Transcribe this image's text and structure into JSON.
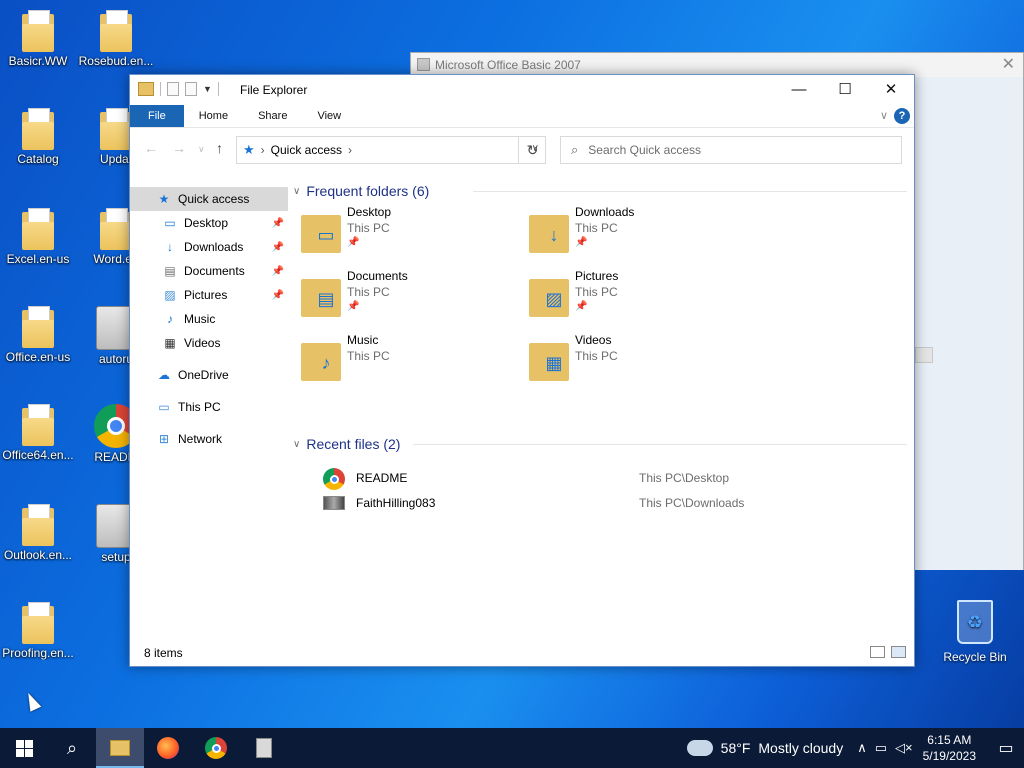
{
  "desktop": {
    "icons": [
      {
        "label": "Basicr.WW",
        "kind": "folder"
      },
      {
        "label": "Rosebud.en...",
        "kind": "folder"
      },
      {
        "label": "Catalog",
        "kind": "folder"
      },
      {
        "label": "Updat",
        "kind": "folder"
      },
      {
        "label": "Excel.en-us",
        "kind": "folder"
      },
      {
        "label": "Word.en",
        "kind": "folder"
      },
      {
        "label": "Office.en-us",
        "kind": "folder"
      },
      {
        "label": "autoru",
        "kind": "setup"
      },
      {
        "label": "Office64.en...",
        "kind": "folder"
      },
      {
        "label": "READM",
        "kind": "chrome"
      },
      {
        "label": "Outlook.en...",
        "kind": "folder"
      },
      {
        "label": "setup",
        "kind": "setup"
      },
      {
        "label": "Proofing.en...",
        "kind": "folder"
      }
    ],
    "recycle_bin": "Recycle Bin"
  },
  "office_window": {
    "title": "Microsoft Office Basic 2007",
    "close": "✕"
  },
  "explorer": {
    "title": "File Explorer",
    "controls": {
      "minimize": "—",
      "maximize": "☐",
      "close": "✕"
    },
    "ribbon_tabs": [
      "File",
      "Home",
      "Share",
      "View"
    ],
    "address": {
      "location": "Quick access"
    },
    "search_placeholder": "Search Quick access",
    "sidebar": [
      {
        "label": "Quick access",
        "icon": "star-icon",
        "glyph": "★",
        "color": "#1a74d6",
        "selected": true,
        "sub": false,
        "pinned": false
      },
      {
        "label": "Desktop",
        "icon": "desktop-icon",
        "glyph": "▭",
        "color": "#1a74d6",
        "selected": false,
        "sub": true,
        "pinned": true
      },
      {
        "label": "Downloads",
        "icon": "download-icon",
        "glyph": "↓",
        "color": "#1a74d6",
        "selected": false,
        "sub": true,
        "pinned": true
      },
      {
        "label": "Documents",
        "icon": "document-icon",
        "glyph": "▤",
        "color": "#6d6d6d",
        "selected": false,
        "sub": true,
        "pinned": true
      },
      {
        "label": "Pictures",
        "icon": "picture-icon",
        "glyph": "▨",
        "color": "#3a8ad6",
        "selected": false,
        "sub": true,
        "pinned": true
      },
      {
        "label": "Music",
        "icon": "music-icon",
        "glyph": "♪",
        "color": "#1a74d6",
        "selected": false,
        "sub": true,
        "pinned": false
      },
      {
        "label": "Videos",
        "icon": "video-icon",
        "glyph": "▦",
        "color": "#333333",
        "selected": false,
        "sub": true,
        "pinned": false
      },
      {
        "label": "OneDrive",
        "icon": "cloud-icon",
        "glyph": "☁",
        "color": "#1a74d6",
        "selected": false,
        "sub": false,
        "pinned": false
      },
      {
        "label": "This PC",
        "icon": "computer-icon",
        "glyph": "▭",
        "color": "#3a8ad6",
        "selected": false,
        "sub": false,
        "pinned": false
      },
      {
        "label": "Network",
        "icon": "network-icon",
        "glyph": "⊞",
        "color": "#3a8ad6",
        "selected": false,
        "sub": false,
        "pinned": false
      }
    ],
    "frequent": {
      "header": "Frequent folders (6)",
      "folders": [
        {
          "name": "Desktop",
          "location": "This PC",
          "pinned": true,
          "icon": "desktop-folder-icon",
          "glyph": "▭"
        },
        {
          "name": "Downloads",
          "location": "This PC",
          "pinned": true,
          "icon": "downloads-folder-icon",
          "glyph": "↓"
        },
        {
          "name": "Documents",
          "location": "This PC",
          "pinned": true,
          "icon": "documents-folder-icon",
          "glyph": "▤"
        },
        {
          "name": "Pictures",
          "location": "This PC",
          "pinned": true,
          "icon": "pictures-folder-icon",
          "glyph": "▨"
        },
        {
          "name": "Music",
          "location": "This PC",
          "pinned": false,
          "icon": "music-folder-icon",
          "glyph": "♪"
        },
        {
          "name": "Videos",
          "location": "This PC",
          "pinned": false,
          "icon": "videos-folder-icon",
          "glyph": "▦"
        }
      ]
    },
    "recent": {
      "header": "Recent files (2)",
      "files": [
        {
          "name": "README",
          "path": "This PC\\Desktop",
          "icon": "chrome-icon"
        },
        {
          "name": "FaithHilling083",
          "path": "This PC\\Downloads",
          "icon": "image-file-icon"
        }
      ]
    },
    "status": {
      "items": "8 items"
    }
  },
  "taskbar": {
    "weather": {
      "temp": "58°F",
      "condition": "Mostly cloudy"
    },
    "clock": {
      "time": "6:15 AM",
      "date": "5/19/2023"
    }
  },
  "colors": {
    "accent": "#1a66b5",
    "taskbar": "#0b1a36",
    "header": "#1e3287"
  }
}
